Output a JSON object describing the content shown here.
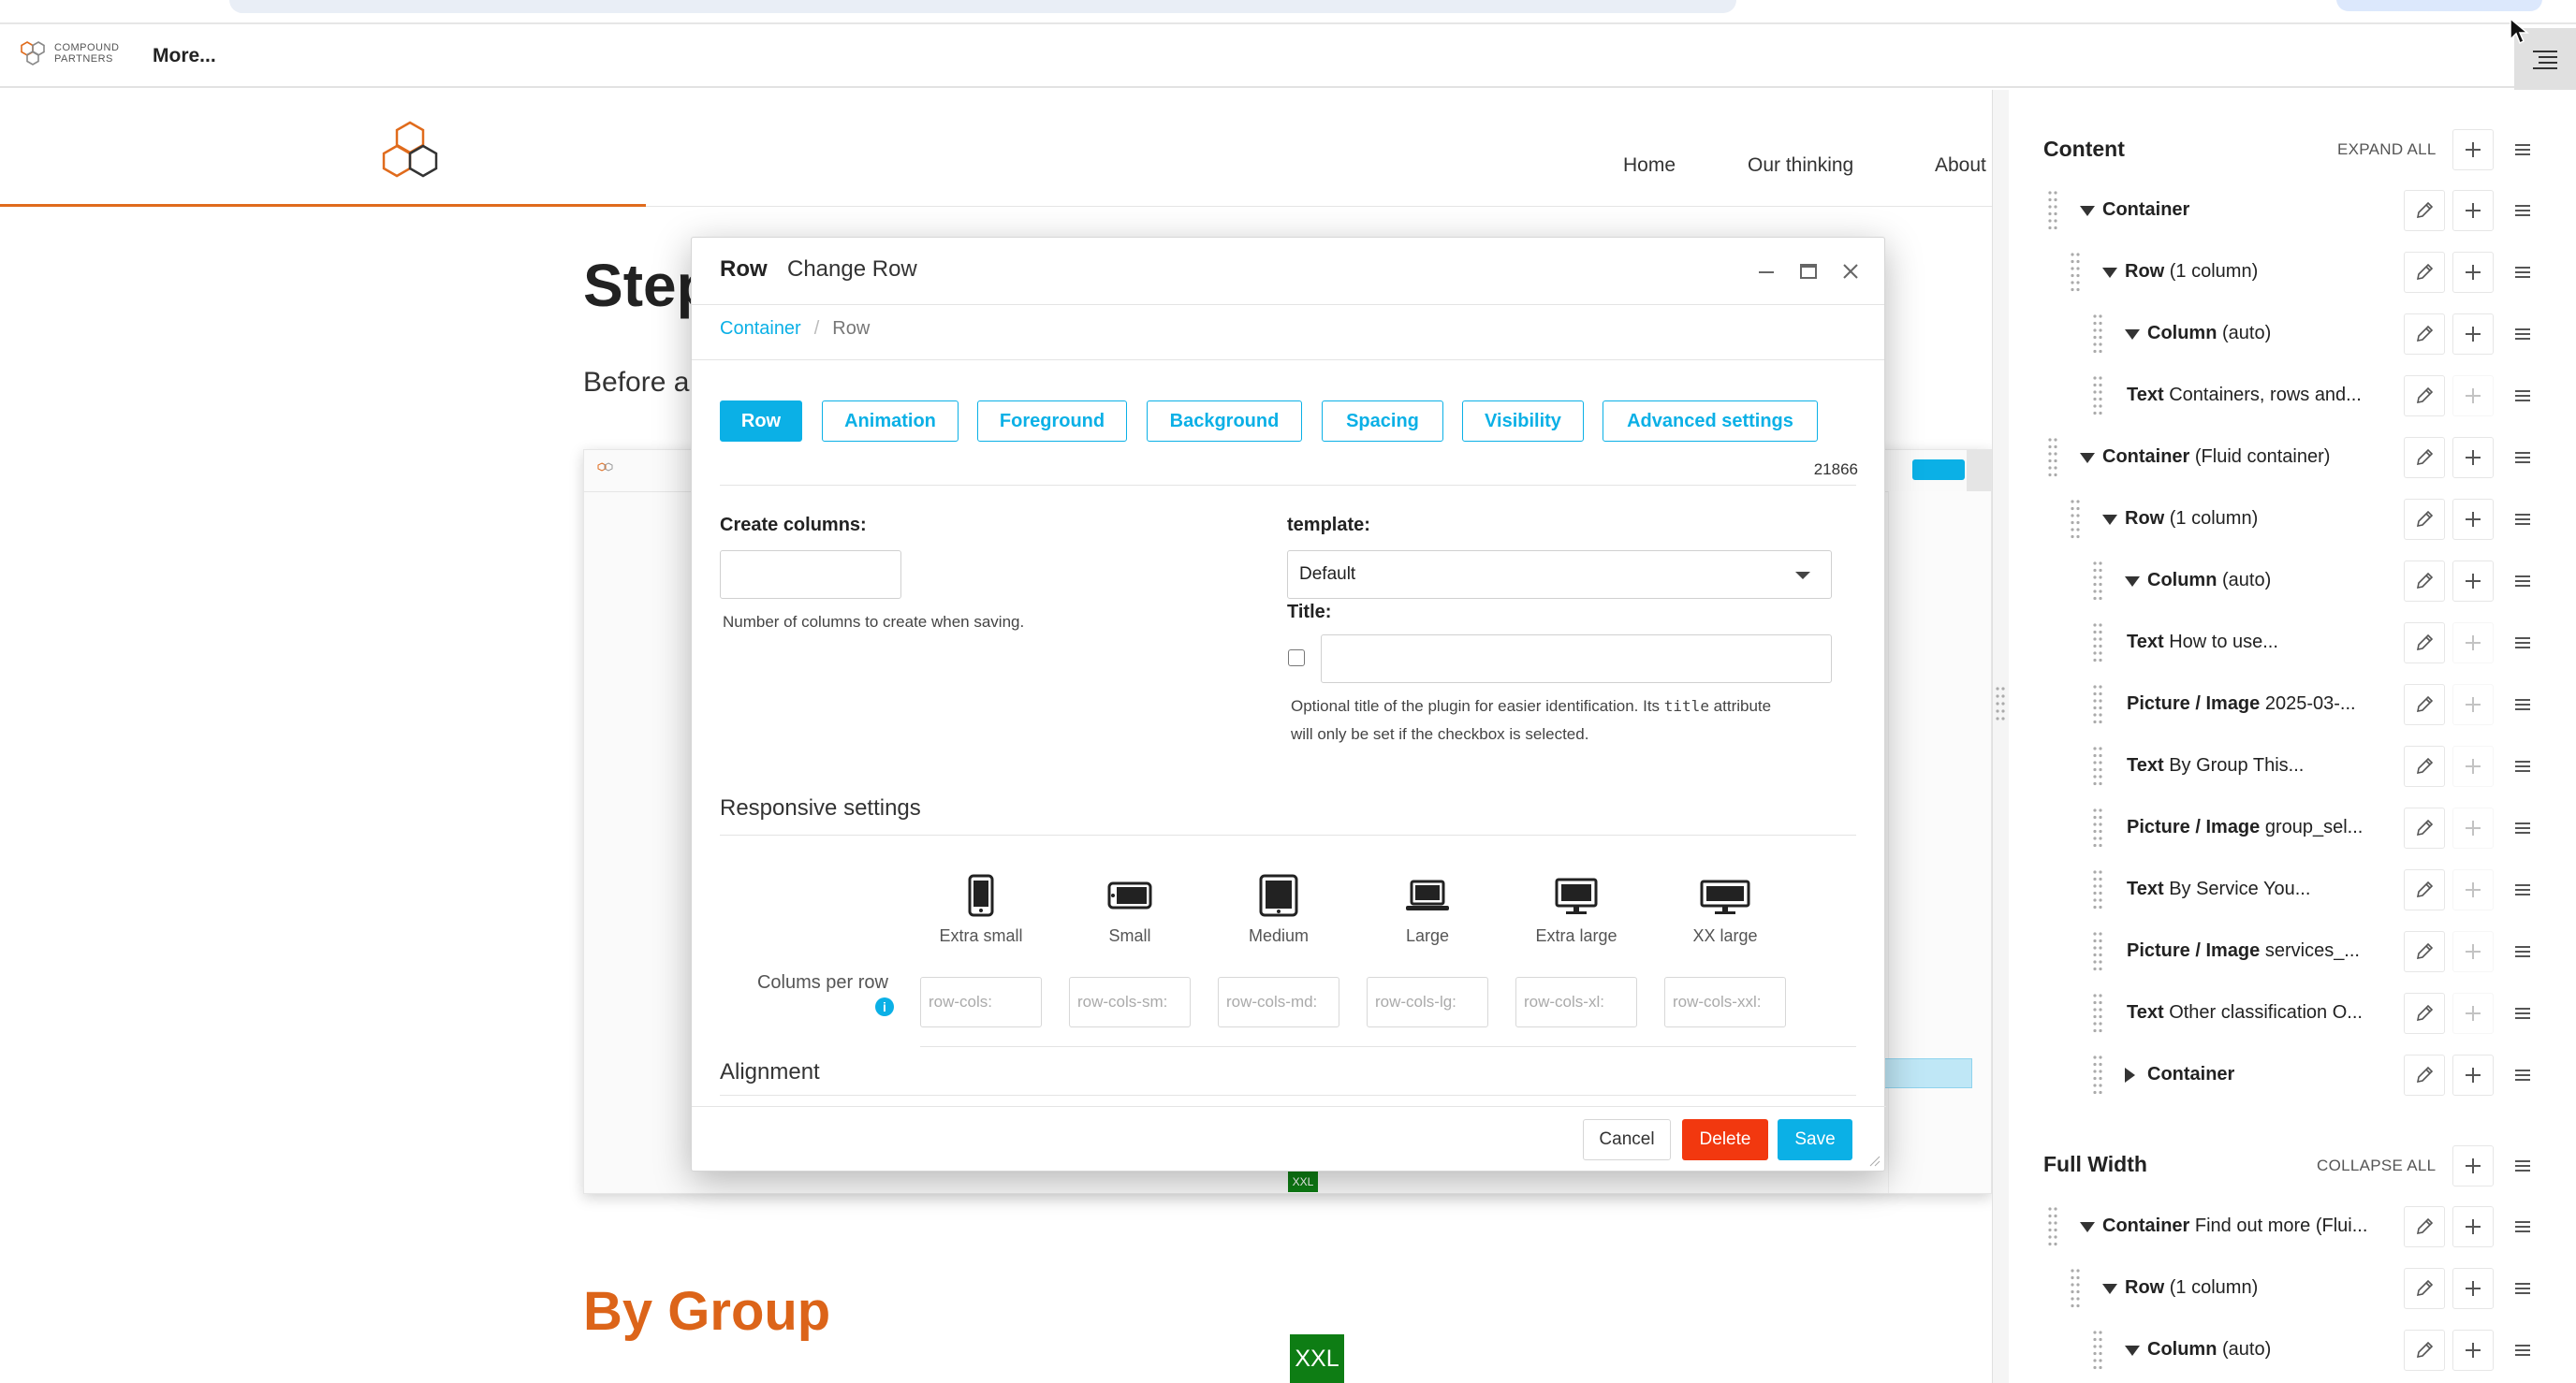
{
  "toolbar": {
    "logo_line1": "COMPOUND",
    "logo_line2": "PARTNERS",
    "more_label": "More...",
    "structure_toggle_icon": "structure-list-icon"
  },
  "site": {
    "nav": [
      "Home",
      "Our thinking",
      "About"
    ],
    "heading": "Step",
    "intro": "Before a",
    "section_heading": "By Group",
    "breakpoint_badge": "XXL",
    "accent_color": "#dc6419"
  },
  "modal": {
    "title": "Row",
    "subtitle": "Change Row",
    "breadcrumb": {
      "parent": "Container",
      "current": "Row"
    },
    "tabs": [
      "Row",
      "Animation",
      "Foreground",
      "Background",
      "Spacing",
      "Visibility",
      "Advanced settings"
    ],
    "id_number": "21866",
    "create_columns_label": "Create columns:",
    "create_columns_value": "",
    "create_columns_help": "Number of columns to create when saving.",
    "template_label": "template:",
    "template_value": "Default",
    "title_label": "Title:",
    "title_value": "",
    "title_help_1": "Optional title of the plugin for easier identification. Its ",
    "title_help_code": "title",
    "title_help_2": " attribute",
    "title_help_3": "will only be set if the checkbox is selected.",
    "responsive_heading": "Responsive settings",
    "devices": [
      "Extra small",
      "Small",
      "Medium",
      "Large",
      "Extra large",
      "XX large"
    ],
    "cols_label": "Colums per row",
    "cols_placeholders": [
      "row-cols:",
      "row-cols-sm:",
      "row-cols-md:",
      "row-cols-lg:",
      "row-cols-xl:",
      "row-cols-xxl:"
    ],
    "alignment_heading": "Alignment",
    "cancel_label": "Cancel",
    "delete_label": "Delete",
    "save_label": "Save",
    "accent_color": "#0bb0e6",
    "delete_color": "#f2380f"
  },
  "structure": {
    "content_title": "Content",
    "content_action": "EXPAND ALL",
    "content_items": [
      {
        "bold": "Container",
        "rest": "",
        "expander": "open",
        "add_enabled": true
      },
      {
        "bold": "Row",
        "rest": " (1 column)",
        "expander": "open",
        "add_enabled": true
      },
      {
        "bold": "Column",
        "rest": " (auto)",
        "expander": "open",
        "add_enabled": true
      },
      {
        "bold": "Text",
        "rest": " Containers, rows and...",
        "expander": "none",
        "add_enabled": false
      },
      {
        "bold": "Container",
        "rest": " (Fluid container)",
        "expander": "open",
        "add_enabled": true
      },
      {
        "bold": "Row",
        "rest": " (1 column)",
        "expander": "open",
        "add_enabled": true
      },
      {
        "bold": "Column",
        "rest": " (auto)",
        "expander": "open",
        "add_enabled": true
      },
      {
        "bold": "Text",
        "rest": " How to use...",
        "expander": "none",
        "add_enabled": false
      },
      {
        "bold": "Picture / Image",
        "rest": " 2025-03-...",
        "expander": "none",
        "add_enabled": false
      },
      {
        "bold": "Text",
        "rest": " By Group This...",
        "expander": "none",
        "add_enabled": false
      },
      {
        "bold": "Picture / Image",
        "rest": " group_sel...",
        "expander": "none",
        "add_enabled": false
      },
      {
        "bold": "Text",
        "rest": " By Service You...",
        "expander": "none",
        "add_enabled": false
      },
      {
        "bold": "Picture / Image",
        "rest": " services_...",
        "expander": "none",
        "add_enabled": false
      },
      {
        "bold": "Text",
        "rest": " Other classification O...",
        "expander": "none",
        "add_enabled": false
      },
      {
        "bold": "Container",
        "rest": "",
        "expander": "closed",
        "add_enabled": true
      }
    ],
    "fullwidth_title": "Full Width",
    "fullwidth_action": "COLLAPSE ALL",
    "fullwidth_items": [
      {
        "bold": "Container",
        "rest": " Find out more (Flui...",
        "expander": "open",
        "add_enabled": true
      },
      {
        "bold": "Row",
        "rest": " (1 column)",
        "expander": "open",
        "add_enabled": true
      },
      {
        "bold": "Column",
        "rest": " (auto)",
        "expander": "open",
        "add_enabled": true
      }
    ]
  }
}
